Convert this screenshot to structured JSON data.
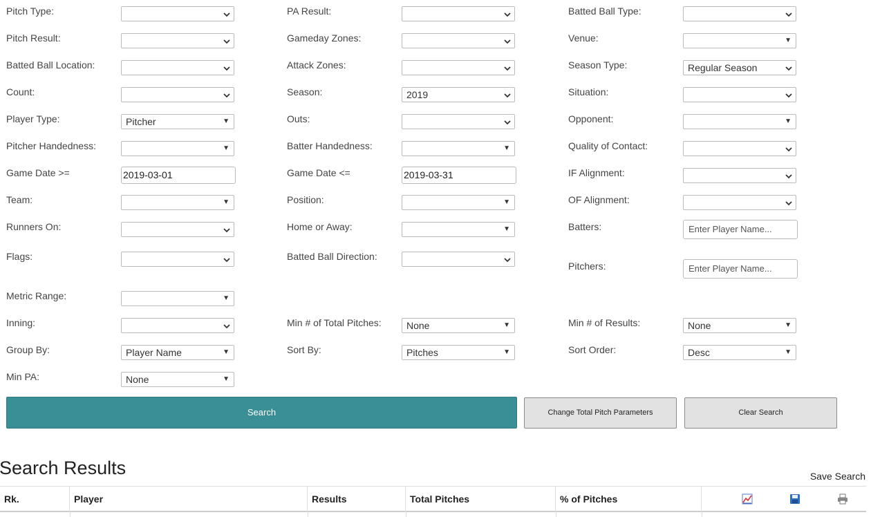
{
  "filters": {
    "col1": [
      {
        "key": "pitch_type",
        "label": "Pitch Type:",
        "value": "",
        "style": "chev"
      },
      {
        "key": "pitch_result",
        "label": "Pitch Result:",
        "value": "",
        "style": "chev"
      },
      {
        "key": "batted_ball_location",
        "label": "Batted Ball Location:",
        "value": "",
        "style": "chev"
      },
      {
        "key": "count",
        "label": "Count:",
        "value": "",
        "style": "chev"
      },
      {
        "key": "player_type",
        "label": "Player Type:",
        "value": "Pitcher",
        "style": "arrow"
      },
      {
        "key": "pitcher_handedness",
        "label": "Pitcher Handedness:",
        "value": "",
        "style": "arrow"
      },
      {
        "key": "game_date_gte",
        "label": "Game Date >=",
        "value": "2019-03-01",
        "style": "input"
      },
      {
        "key": "team",
        "label": "Team:",
        "value": "",
        "style": "arrow"
      },
      {
        "key": "runners_on",
        "label": "Runners On:",
        "value": "",
        "style": "chev"
      },
      {
        "key": "flags",
        "label": "Flags:",
        "value": "",
        "style": "chev"
      },
      {
        "key": "metric_range",
        "label": "Metric Range:",
        "value": "",
        "style": "arrow"
      },
      {
        "key": "inning",
        "label": "Inning:",
        "value": "",
        "style": "chev"
      },
      {
        "key": "group_by",
        "label": "Group By:",
        "value": "Player Name",
        "style": "arrow"
      },
      {
        "key": "min_pa",
        "label": "Min PA:",
        "value": "None",
        "style": "arrow"
      }
    ],
    "col2": [
      {
        "key": "pa_result",
        "label": "PA Result:",
        "value": "",
        "style": "chev"
      },
      {
        "key": "gameday_zones",
        "label": "Gameday Zones:",
        "value": "",
        "style": "chev"
      },
      {
        "key": "attack_zones",
        "label": "Attack Zones:",
        "value": "",
        "style": "chev"
      },
      {
        "key": "season",
        "label": "Season:",
        "value": "2019",
        "style": "chev"
      },
      {
        "key": "outs",
        "label": "Outs:",
        "value": "",
        "style": "chev"
      },
      {
        "key": "batter_handedness",
        "label": "Batter Handedness:",
        "value": "",
        "style": "arrow"
      },
      {
        "key": "game_date_lte",
        "label": "Game Date <=",
        "value": "2019-03-31",
        "style": "input"
      },
      {
        "key": "position",
        "label": "Position:",
        "value": "",
        "style": "arrow"
      },
      {
        "key": "home_or_away",
        "label": "Home or Away:",
        "value": "",
        "style": "arrow"
      },
      {
        "key": "batted_ball_direction",
        "label": "Batted Ball Direction:",
        "value": "",
        "style": "chev"
      },
      {
        "key": "min_total_pitches",
        "label": "Min # of Total Pitches:",
        "value": "None",
        "style": "arrow"
      },
      {
        "key": "sort_by",
        "label": "Sort By:",
        "value": "Pitches",
        "style": "arrow"
      }
    ],
    "col3": [
      {
        "key": "batted_ball_type",
        "label": "Batted Ball Type:",
        "value": "",
        "style": "chev"
      },
      {
        "key": "venue",
        "label": "Venue:",
        "value": "",
        "style": "arrow"
      },
      {
        "key": "season_type",
        "label": "Season Type:",
        "value": "Regular Season",
        "style": "chev"
      },
      {
        "key": "situation",
        "label": "Situation:",
        "value": "",
        "style": "chev"
      },
      {
        "key": "opponent",
        "label": "Opponent:",
        "value": "",
        "style": "arrow"
      },
      {
        "key": "quality_of_contact",
        "label": "Quality of Contact:",
        "value": "",
        "style": "chev"
      },
      {
        "key": "if_alignment",
        "label": "IF Alignment:",
        "value": "",
        "style": "chev"
      },
      {
        "key": "of_alignment",
        "label": "OF Alignment:",
        "value": "",
        "style": "chev"
      },
      {
        "key": "batters",
        "label": "Batters:",
        "placeholder": "Enter Player Name...",
        "style": "text"
      },
      {
        "key": "pitchers",
        "label": "Pitchers:",
        "placeholder": "Enter Player Name...",
        "style": "text"
      },
      {
        "key": "min_results",
        "label": "Min # of Results:",
        "value": "None",
        "style": "arrow"
      },
      {
        "key": "sort_order",
        "label": "Sort Order:",
        "value": "Desc",
        "style": "arrow"
      }
    ]
  },
  "buttons": {
    "search": "Search",
    "change_total": "Change Total Pitch Parameters",
    "clear": "Clear Search"
  },
  "results": {
    "title": "Search Results",
    "save_search": "Save Search",
    "columns": [
      "Rk.",
      "Player",
      "Results",
      "Total Pitches",
      "% of Pitches"
    ],
    "icons": [
      "chart-icon",
      "save-icon",
      "print-icon"
    ]
  }
}
